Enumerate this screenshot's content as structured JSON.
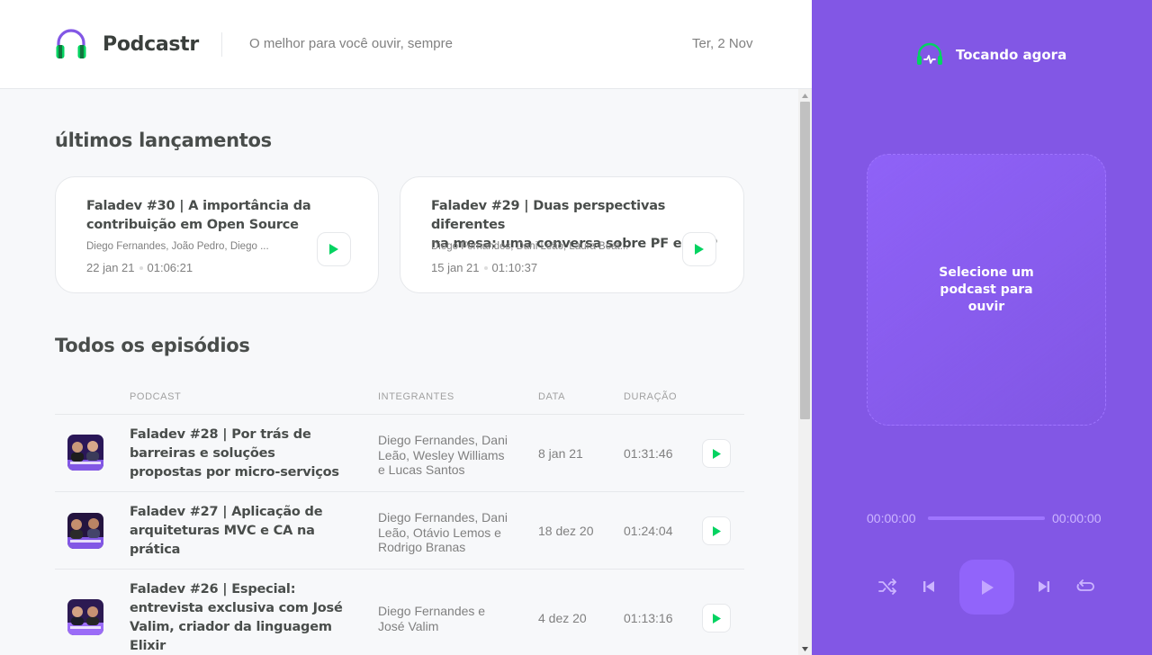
{
  "header": {
    "app_name": "Podcastr",
    "tagline": "O melhor para você ouvir, sempre",
    "date": "Ter, 2 Nov"
  },
  "latest": {
    "title": "últimos lançamentos",
    "episodes": [
      {
        "title_line1": "Faladev #30 | A importância da",
        "title_line2": "contribuição em Open Source",
        "members": "Diego Fernandes, João Pedro, Diego ...",
        "date": "22 jan 21",
        "duration": "01:06:21"
      },
      {
        "title_line1": "Faladev #29 | Duas perspectivas diferentes",
        "title_line2": "na mesa: uma conversa sobre PF e OOP",
        "members": "Diego Fernandes, Dani Leão, Laura Beat...",
        "date": "15 jan 21",
        "duration": "01:10:37"
      }
    ]
  },
  "all": {
    "title": "Todos os episódios",
    "columns": {
      "podcast": "Podcast",
      "members": "Integrantes",
      "date": "Data",
      "duration": "Duração"
    },
    "rows": [
      {
        "title": "Faladev #28 | Por trás de barreiras e soluções propostas por micro-serviços",
        "members": "Diego Fernandes, Dani Leão, Wesley Williams e Lucas Santos",
        "date": "8 jan 21",
        "duration": "01:31:46"
      },
      {
        "title": "Faladev #27 | Aplicação de arquiteturas MVC e CA na prática",
        "members": "Diego Fernandes, Dani Leão, Otávio Lemos e Rodrigo Branas",
        "date": "18 dez 20",
        "duration": "01:24:04"
      },
      {
        "title": "Faladev #26 | Especial: entrevista exclusiva com José Valim, criador da linguagem Elixir",
        "members": "Diego Fernandes e José Valim",
        "date": "4 dez 20",
        "duration": "01:13:16"
      }
    ]
  },
  "player": {
    "label": "Tocando agora",
    "empty_text": "Selecione um podcast para ouvir",
    "current_time": "00:00:00",
    "total_time": "00:00:00",
    "progress": 0
  },
  "colors": {
    "brand": "#8257e5",
    "play_green": "#04d361",
    "text": "#494d4b",
    "muted": "#808080"
  },
  "icons": {
    "logo": "headphones-icon",
    "now_playing": "headphones-wave-icon",
    "play": "play-icon",
    "shuffle": "shuffle-icon",
    "previous": "play-previous-icon",
    "next": "play-next-icon",
    "repeat": "repeat-icon"
  }
}
